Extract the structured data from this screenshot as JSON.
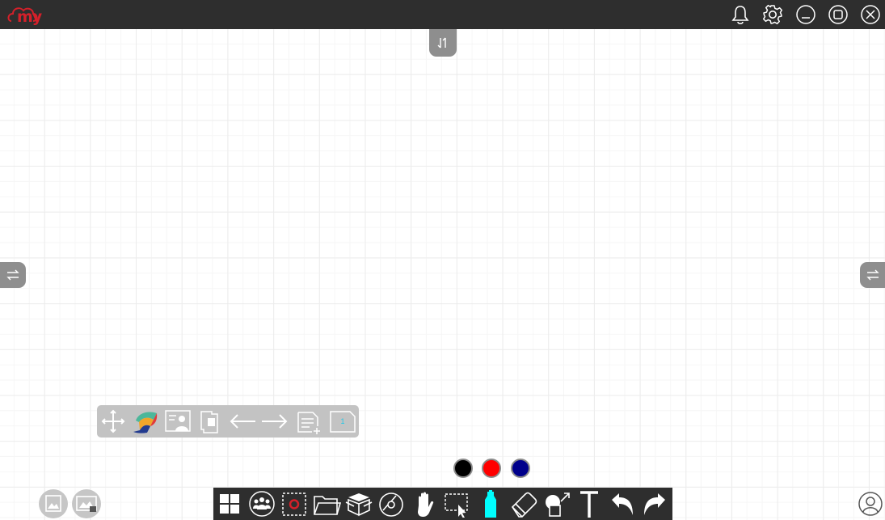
{
  "app": {
    "logo_text": "my",
    "brand_color": "#d4202a",
    "titlebar_icons": [
      "bell-icon",
      "gear-icon",
      "minimize-icon",
      "maximize-icon",
      "close-icon"
    ]
  },
  "panels": {
    "top_toggle_icon": "swap-vertical-icon",
    "left_toggle_icon": "swap-horizontal-icon",
    "right_toggle_icon": "swap-horizontal-icon"
  },
  "page_toolbar": {
    "items": [
      "move-icon",
      "palette-icon",
      "presenter-icon",
      "page-template-icon",
      "previous-page-icon",
      "next-page-icon",
      "add-page-icon",
      "page-counter-icon"
    ],
    "current_page": "1"
  },
  "pen_colors": [
    "#000000",
    "#ff0000",
    "#00008b"
  ],
  "main_toolbar": {
    "items": [
      "windows-icon",
      "participants-icon",
      "screen-record-icon",
      "folder-icon",
      "toolbox-icon",
      "media-disc-icon",
      "hand-pan-icon",
      "select-icon",
      "highlighter-icon",
      "eraser-icon",
      "shape-icon",
      "text-icon",
      "undo-icon",
      "redo-icon"
    ],
    "highlighter_color": "#00ffff"
  },
  "bottom_left": [
    "gallery-icon",
    "background-gallery-icon"
  ],
  "bottom_right": "user-profile-icon"
}
